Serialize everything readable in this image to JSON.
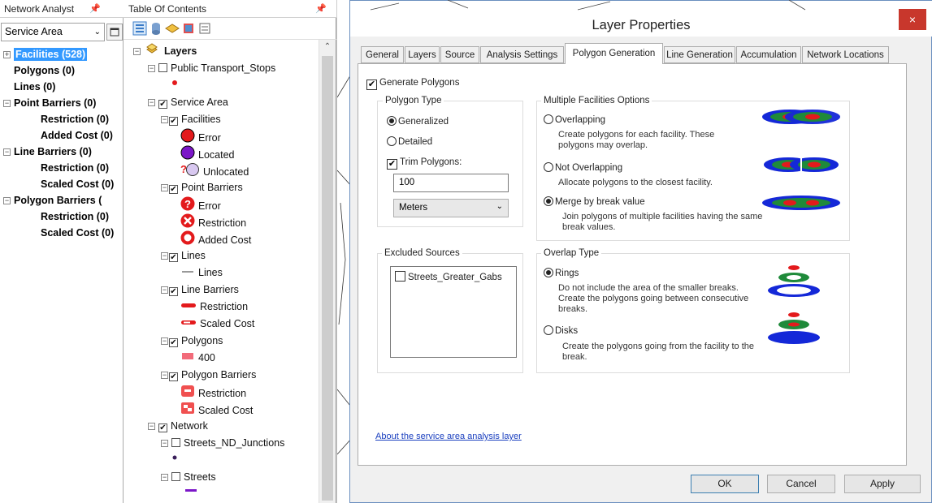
{
  "network_analyst": {
    "title": "Network Analyst",
    "pin": "p ×",
    "dropdown_value": "Service Area",
    "items": [
      {
        "label": "Facilities (528)",
        "indent": 0,
        "expander": "+",
        "selected": true
      },
      {
        "label": "Polygons (0)",
        "indent": 0,
        "expander": "",
        "selected": false
      },
      {
        "label": "Lines (0)",
        "indent": 0,
        "expander": "",
        "selected": false
      },
      {
        "label": "Point Barriers (0)",
        "indent": 0,
        "expander": "−",
        "selected": false
      },
      {
        "label": "Restriction (0)",
        "indent": 1,
        "expander": "",
        "selected": false
      },
      {
        "label": "Added Cost (0)",
        "indent": 1,
        "expander": "",
        "selected": false
      },
      {
        "label": "Line Barriers (0)",
        "indent": 0,
        "expander": "−",
        "selected": false
      },
      {
        "label": "Restriction (0)",
        "indent": 1,
        "expander": "",
        "selected": false
      },
      {
        "label": "Scaled Cost (0)",
        "indent": 1,
        "expander": "",
        "selected": false
      },
      {
        "label": "Polygon Barriers (",
        "indent": 0,
        "expander": "−",
        "selected": false
      },
      {
        "label": "Restriction (0)",
        "indent": 1,
        "expander": "",
        "selected": false
      },
      {
        "label": "Scaled Cost (0)",
        "indent": 1,
        "expander": "",
        "selected": false
      }
    ]
  },
  "toc": {
    "title": "Table Of Contents",
    "pin": "p ×",
    "root_label": "Layers",
    "rows": [
      {
        "label": "Public Transport_Stops",
        "level": 1,
        "kind": "layer",
        "checked": false
      },
      {
        "label": "",
        "level": 3,
        "kind": "sym",
        "sym": "reddot-small"
      },
      {
        "label": "Service Area",
        "level": 1,
        "kind": "layer",
        "checked": true
      },
      {
        "label": "Facilities",
        "level": 2,
        "kind": "layer",
        "checked": true
      },
      {
        "label": "Error",
        "level": 3,
        "kind": "sym",
        "sym": "red-circle"
      },
      {
        "label": "Located",
        "level": 3,
        "kind": "sym",
        "sym": "purple-circle"
      },
      {
        "label": "Unlocated",
        "level": 3,
        "kind": "sym",
        "sym": "unlocated"
      },
      {
        "label": "Point Barriers",
        "level": 2,
        "kind": "layer",
        "checked": true
      },
      {
        "label": "Error",
        "level": 3,
        "kind": "sym",
        "sym": "question-red"
      },
      {
        "label": "Restriction",
        "level": 3,
        "kind": "sym",
        "sym": "x-red"
      },
      {
        "label": "Added Cost",
        "level": 3,
        "kind": "sym",
        "sym": "ring-red"
      },
      {
        "label": "Lines",
        "level": 2,
        "kind": "layer",
        "checked": true
      },
      {
        "label": "Lines",
        "level": 3,
        "kind": "sym",
        "sym": "dash-line"
      },
      {
        "label": "Line Barriers",
        "level": 2,
        "kind": "layer",
        "checked": true
      },
      {
        "label": "Restriction",
        "level": 3,
        "kind": "sym",
        "sym": "red-bar"
      },
      {
        "label": "Scaled Cost",
        "level": 3,
        "kind": "sym",
        "sym": "red-bar-outline"
      },
      {
        "label": "Polygons",
        "level": 2,
        "kind": "layer",
        "checked": true
      },
      {
        "label": "400",
        "level": 3,
        "kind": "sym",
        "sym": "pink-rect"
      },
      {
        "label": "Polygon Barriers",
        "level": 2,
        "kind": "layer",
        "checked": true
      },
      {
        "label": "Restriction",
        "level": 3,
        "kind": "sym",
        "sym": "red-square"
      },
      {
        "label": "Scaled Cost",
        "level": 3,
        "kind": "sym",
        "sym": "red-square-cost"
      },
      {
        "label": "Network",
        "level": 1,
        "kind": "layer",
        "checked": true
      },
      {
        "label": "Streets_ND_Junctions",
        "level": 2,
        "kind": "layer",
        "checked": false
      },
      {
        "label": "",
        "level": 3,
        "kind": "sym",
        "sym": "darkdot"
      },
      {
        "label": "Streets",
        "level": 2,
        "kind": "layer",
        "checked": false
      }
    ]
  },
  "dialog": {
    "title": "Layer Properties",
    "close": "×",
    "tabs": [
      {
        "label": "General",
        "active": false
      },
      {
        "label": "Layers",
        "active": false
      },
      {
        "label": "Source",
        "active": false
      },
      {
        "label": "Analysis Settings",
        "active": false
      },
      {
        "label": "Polygon Generation",
        "active": true
      },
      {
        "label": "Line Generation",
        "active": false
      },
      {
        "label": "Accumulation",
        "active": false
      },
      {
        "label": "Network Locations",
        "active": false
      }
    ],
    "generate_polygons": "Generate Polygons",
    "polygon_type": {
      "label": "Polygon Type",
      "generalized": "Generalized",
      "detailed": "Detailed",
      "trim": "Trim Polygons:",
      "trim_value": "100",
      "units": "Meters"
    },
    "multiple": {
      "label": "Multiple Facilities Options",
      "overlapping": "Overlapping",
      "overlapping_desc": "Create polygons for each facility. These polygons may overlap.",
      "not_overlapping": "Not Overlapping",
      "not_overlapping_desc": "Allocate polygons to the closest facility.",
      "merge": "Merge by break value",
      "merge_desc": "Join polygons of multiple facilities having the same break values."
    },
    "excluded": {
      "label": "Excluded Sources",
      "item": "Streets_Greater_Gabs"
    },
    "overlap": {
      "label": "Overlap Type",
      "rings": "Rings",
      "rings_desc": "Do not include the area of the smaller breaks. Create the polygons going between consecutive breaks.",
      "disks": "Disks",
      "disks_desc": "Create the polygons going from the facility to the break."
    },
    "about_link": "About the service area analysis layer",
    "buttons": {
      "ok": "OK",
      "cancel": "Cancel",
      "apply": "Apply"
    }
  },
  "colors": {
    "selection": "#3399ff",
    "red": "#e31a1c",
    "purple": "#7b16c8",
    "green": "#1f8a3a",
    "blue": "#1428d8"
  }
}
